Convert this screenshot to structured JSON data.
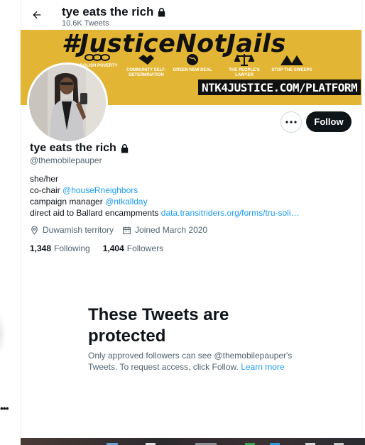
{
  "header": {
    "name": "tye eats the rich",
    "tweet_count": "10.6K Tweets"
  },
  "banner": {
    "headline": "#JusticeNotJails",
    "items": [
      "ABOLISH POVERTY",
      "COMMUNITY SELF-DETERMINATION",
      "GREEN NEW DEAL",
      "THE PEOPLE'S LAWYER",
      "STOP THE SWEEPS"
    ],
    "site": "NTK4JUSTICE.COM/PLATFORM"
  },
  "actions": {
    "follow_label": "Follow"
  },
  "profile": {
    "name": "tye eats the rich",
    "handle": "@themobilepauper",
    "bio": {
      "line1": "she/her",
      "line2_prefix": "co-chair ",
      "line2_link": "@houseRneighbors",
      "line3_prefix": "campaign manager ",
      "line3_link": "@ntkallday",
      "line4_prefix": "direct aid to Ballard encampments ",
      "line4_link": "data.transitriders.org/forms/tru-soli…"
    },
    "location": "Duwamish territory",
    "joined": "Joined March 2020",
    "following_count": "1,348",
    "following_label": "Following",
    "followers_count": "1,404",
    "followers_label": "Followers"
  },
  "protected": {
    "title": "These Tweets are protected",
    "desc_prefix": "Only approved followers can see @themobilepauper's Tweets. To request access, click Follow. ",
    "learn_more": "Learn more"
  },
  "colors": {
    "accent": "#1d9bf0",
    "banner_bg": "#e3b534",
    "text_primary": "#0f1419",
    "text_secondary": "#536471"
  }
}
